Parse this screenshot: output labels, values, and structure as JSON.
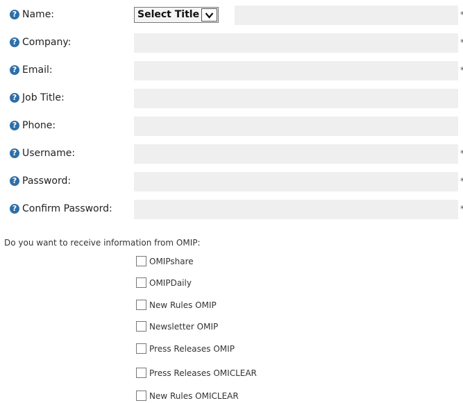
{
  "form": {
    "fields": [
      {
        "label": "Name:",
        "required": true,
        "title_select": "Select Title",
        "value": ""
      },
      {
        "label": "Company:",
        "required": true,
        "value": ""
      },
      {
        "label": "Email:",
        "required": true,
        "value": ""
      },
      {
        "label": "Job Title:",
        "required": false,
        "value": ""
      },
      {
        "label": "Phone:",
        "required": false,
        "value": ""
      },
      {
        "label": "Username:",
        "required": true,
        "value": ""
      },
      {
        "label": "Password:",
        "required": true,
        "value": ""
      },
      {
        "label": "Confirm Password:",
        "required": true,
        "value": ""
      }
    ],
    "required_marker": "*",
    "help_icon": "question-circle-icon",
    "subscription_question": "Do you want to receive information from OMIP:",
    "subscriptions": [
      {
        "label": "OMIPshare",
        "checked": false
      },
      {
        "label": "OMIPDaily",
        "checked": false
      },
      {
        "label": "New Rules OMIP",
        "checked": false
      },
      {
        "label": "Newsletter OMIP",
        "checked": false
      },
      {
        "label": "Press Releases OMIP",
        "checked": false
      },
      {
        "label": "Press Releases OMICLEAR",
        "checked": false
      },
      {
        "label": "New Rules OMICLEAR",
        "checked": false
      }
    ]
  },
  "colors": {
    "help_icon": "#2f6fa8",
    "input_background": "#efefef"
  }
}
